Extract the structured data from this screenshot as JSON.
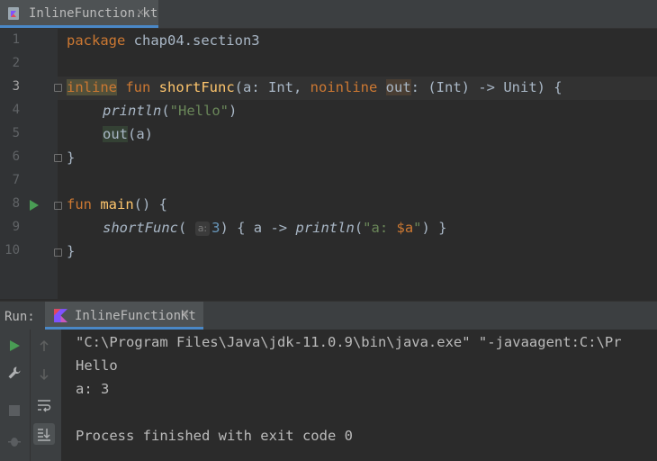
{
  "editor": {
    "tab": {
      "filename": "InlineFunction.kt",
      "close": "×"
    },
    "line_numbers": [
      "1",
      "2",
      "3",
      "4",
      "5",
      "6",
      "7",
      "8",
      "9",
      "10"
    ],
    "lines": {
      "l1": {
        "kw": "package",
        "rest": " chap04.section3"
      },
      "l3": {
        "kw_inline": "inline",
        "kw_fun": " fun ",
        "fn": "shortFunc",
        "p1": "(a: Int, ",
        "kw_noinline": "noinline",
        "sp": " ",
        "param": "out",
        "rest": ": (Int) -> Unit) {"
      },
      "l4": {
        "call": "println",
        "open": "(",
        "str": "\"Hello\"",
        "close": ")"
      },
      "l5": {
        "call": "out",
        "rest": "(a)"
      },
      "l6": {
        "text": "}"
      },
      "l8": {
        "kw": "fun",
        "sp": " ",
        "fn": "main",
        "rest": "() {"
      },
      "l9": {
        "call": "shortFunc",
        "open": "(",
        "hint": "a:",
        "arg": "3",
        "mid": ") { a -> ",
        "call2": "println",
        "open2": "(",
        "str1": "\"a: ",
        "tmpl": "$a",
        "str2": "\"",
        "end": ") }"
      },
      "l10": {
        "text": "}"
      }
    }
  },
  "run": {
    "label": "Run:",
    "tab": {
      "name": "InlineFunctionKt",
      "close": "×"
    },
    "console": [
      "\"C:\\Program Files\\Java\\jdk-11.0.9\\bin\\java.exe\" \"-javaagent:C:\\Pr",
      "Hello",
      "a: 3",
      "",
      "Process finished with exit code 0"
    ]
  },
  "icons": {
    "file": "kotlin-file-icon",
    "run_gutter": "run-arrow-icon",
    "toolbar": [
      "run-icon",
      "wrench-icon",
      "stop-icon",
      "debug-bug-icon",
      "up-arrow-icon",
      "down-arrow-icon",
      "soft-wrap-icon",
      "scroll-to-end-icon"
    ]
  },
  "colors": {
    "accent": "#4a88c7",
    "keyword": "#cc7832",
    "function": "#ffc66d",
    "string": "#6a8759",
    "run_green": "#499c54"
  }
}
